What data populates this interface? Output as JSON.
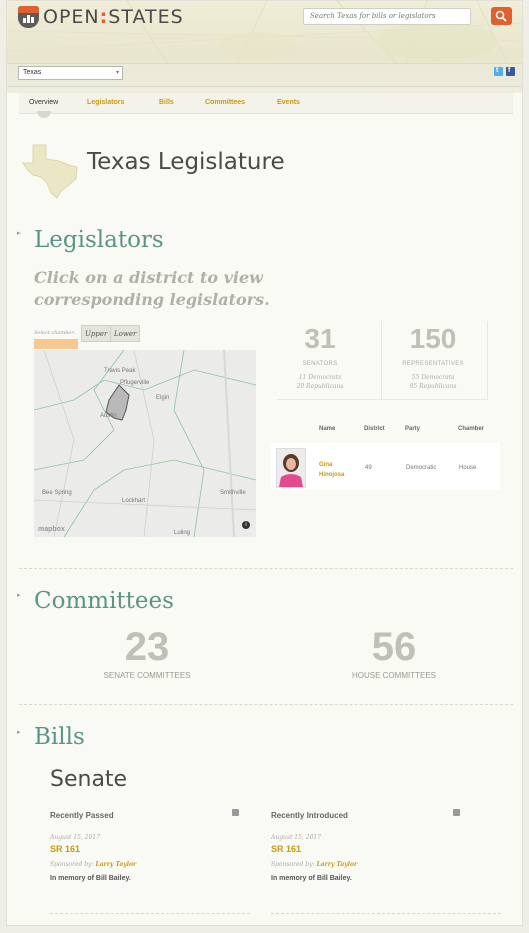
{
  "header": {
    "logo_left": "OPEN",
    "logo_sep": ":",
    "logo_right": "STATES",
    "search_placeholder": "Search Texas for bills or legislators",
    "state_selected": "Texas",
    "social": {
      "twitter": "t",
      "facebook": "f"
    }
  },
  "nav": {
    "items": [
      {
        "label": "Overview",
        "active": true
      },
      {
        "label": "Legislators"
      },
      {
        "label": "Bills"
      },
      {
        "label": "Committees"
      },
      {
        "label": "Events"
      }
    ]
  },
  "page": {
    "title": "Texas Legislature"
  },
  "legislators": {
    "heading": "Legislators",
    "prompt": "Click on a district to view corresponding legislators.",
    "chamber_label": "Select chamber:",
    "chamber_buttons": [
      "Upper",
      "Lower"
    ],
    "map": {
      "labels": [
        "Travis Peak",
        "Pflugerville",
        "Austin",
        "Elgin",
        "Bee Spring",
        "Lockhart",
        "Smithville",
        "Luling"
      ],
      "attribution": "mapbox",
      "info": "i"
    },
    "stats": {
      "senators": {
        "count": "31",
        "label": "SENATORS",
        "dems": "11 Democrats",
        "reps": "20 Republicans"
      },
      "representatives": {
        "count": "150",
        "label": "REPRESENTATIVES",
        "dems": "55 Democrats",
        "reps": "95 Republicans"
      }
    },
    "table": {
      "headers": [
        "Name",
        "District",
        "Party",
        "Chamber"
      ],
      "rows": [
        {
          "name_first": "Gina",
          "name_last": "Hinojosa",
          "district": "49",
          "party": "Democratic",
          "chamber": "House"
        }
      ]
    }
  },
  "committees": {
    "heading": "Committees",
    "senate": {
      "count": "23",
      "label": "SENATE COMMITTEES"
    },
    "house": {
      "count": "56",
      "label": "HOUSE COMMITTEES"
    }
  },
  "bills": {
    "heading": "Bills",
    "chamber": "Senate",
    "columns": [
      {
        "heading": "Recently Passed",
        "date": "August 15, 2017",
        "id": "SR 161",
        "sponsor_label": "Sponsored by:",
        "sponsor": "Larry Taylor",
        "title": "In memory of Bill Bailey."
      },
      {
        "heading": "Recently Introduced",
        "date": "August 15, 2017",
        "id": "SR 161",
        "sponsor_label": "Sponsored by:",
        "sponsor": "Larry Taylor",
        "title": "In memory of Bill Bailey."
      }
    ]
  },
  "colors": {
    "accent": "#e35f2e",
    "section": "#5a9684",
    "link": "#c89a12"
  }
}
